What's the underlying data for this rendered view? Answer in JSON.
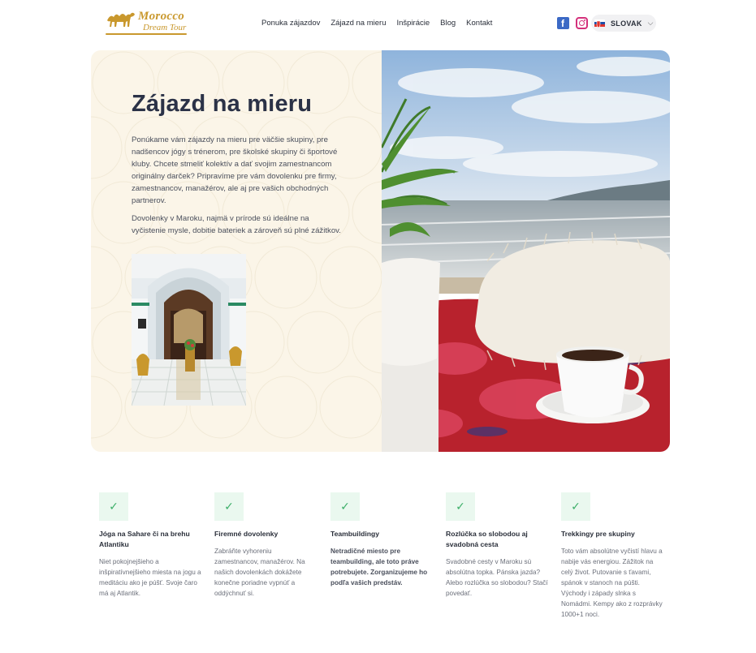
{
  "brand": {
    "logo_line1": "Morocco",
    "logo_line2": "Dream Tour",
    "accent": "#c9982d"
  },
  "nav": {
    "items": [
      {
        "label": "Ponuka zájazdov"
      },
      {
        "label": "Zájazd na mieru"
      },
      {
        "label": "Inšpirácie"
      },
      {
        "label": "Blog"
      },
      {
        "label": "Kontakt"
      }
    ]
  },
  "social": {
    "facebook_glyph": "f"
  },
  "language": {
    "selected": "SLOVAK",
    "chevron": "⌵"
  },
  "hero": {
    "title": "Zájazd na mieru",
    "paragraph1": "Ponúkame vám zájazdy na mieru pre väčšie skupiny, pre nadšencov jógy s trénerom, pre školské skupiny či športové kluby. Chcete stmeliť kolektív a dať svojim zamestnancom originálny darček? Pripravíme pre vám dovolenku pre firmy, zamestnancov, manažérov, ale aj pre vašich obchodných partnerov.",
    "paragraph2": "Dovolenky v Maroku, najmä v prírode sú ideálne na vyčistenie mysle, dobitie bateriek a zároveň sú plné zážitkov.",
    "background": "#fbf5e8"
  },
  "features": [
    {
      "icon": "check-icon",
      "glyph": "✓",
      "title": "Jóga na Sahare či na brehu Atlantiku",
      "desc": "Niet pokojnejšieho a inšpiratívnejšieho miesta na jogu a meditáciu ako je púšť. Svoje čaro má aj Atlantik."
    },
    {
      "icon": "check-icon",
      "glyph": "✓",
      "title": "Firemné dovolenky",
      "desc": "Zabráňte vyhoreniu zamestnancov, manažérov. Na našich dovolenkách dokážete konečne poriadne vypnúť a oddýchnuť si."
    },
    {
      "icon": "check-icon",
      "glyph": "✓",
      "title": "Teambuildingy",
      "desc": "Netradičné miesto pre teambuilding, ale toto práve potrebujete. Zorganizujeme ho podľa vašich predstáv."
    },
    {
      "icon": "check-icon",
      "glyph": "✓",
      "title": "Rozlúčka so slobodou aj svadobná cesta",
      "desc": "Svadobné cesty v Maroku sú absolútna topka. Pánska jazda? Alebo rozlúčka so slobodou? Stačí povedať."
    },
    {
      "icon": "check-icon",
      "glyph": "✓",
      "title": "Trekkingy pre skupiny",
      "desc": "Toto vám absolútne vyčistí hlavu a nabije vás energiou. Zážitok na celý život. Putovanie s ťavami, spánok v stanoch na púšti. Východy i západy slnka s Nomádmi. Kempy ako z rozprávky 1000+1 noci."
    }
  ]
}
